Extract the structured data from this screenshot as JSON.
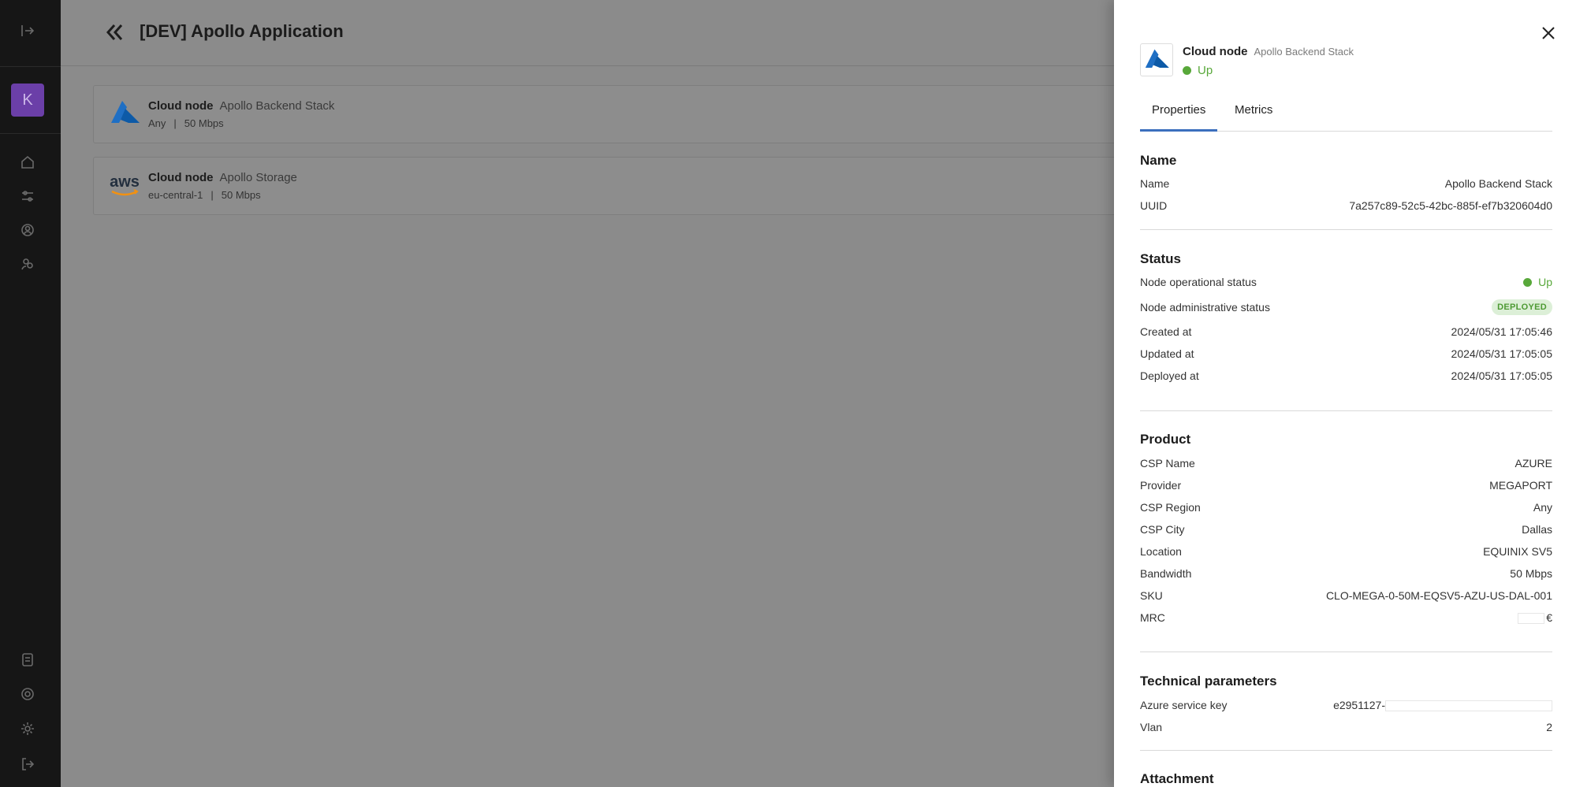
{
  "app": {
    "title": "[DEV] Apollo Application",
    "avatar_letter": "K"
  },
  "nodes": [
    {
      "type_label": "Cloud node",
      "name": "Apollo Backend Stack",
      "region": "Any",
      "bandwidth": "50 Mbps",
      "provider_icon": "azure-logo"
    },
    {
      "type_label": "Cloud node",
      "name": "Apollo Storage",
      "region": "eu-central-1",
      "bandwidth": "50 Mbps",
      "provider_icon": "aws-logo",
      "logo_text": "aws"
    }
  ],
  "drawer": {
    "type_label": "Cloud node",
    "name": "Apollo Backend Stack",
    "status": "Up",
    "tabs": [
      "Properties",
      "Metrics"
    ],
    "sections": {
      "name": {
        "title": "Name",
        "rows": [
          {
            "label": "Name",
            "value": "Apollo Backend Stack"
          },
          {
            "label": "UUID",
            "value": "7a257c89-52c5-42bc-885f-ef7b320604d0"
          }
        ]
      },
      "status": {
        "title": "Status",
        "operational_label": "Node operational status",
        "operational_value": "Up",
        "administrative_label": "Node administrative status",
        "administrative_value": "DEPLOYED",
        "rows": [
          {
            "label": "Created at",
            "value": "2024/05/31 17:05:46"
          },
          {
            "label": "Updated at",
            "value": "2024/05/31 17:05:05"
          },
          {
            "label": "Deployed at",
            "value": "2024/05/31 17:05:05"
          }
        ]
      },
      "product": {
        "title": "Product",
        "rows": [
          {
            "label": "CSP Name",
            "value": "AZURE"
          },
          {
            "label": "Provider",
            "value": "MEGAPORT"
          },
          {
            "label": "CSP Region",
            "value": "Any"
          },
          {
            "label": "CSP City",
            "value": "Dallas"
          },
          {
            "label": "Location",
            "value": "EQUINIX SV5"
          },
          {
            "label": "Bandwidth",
            "value": "50 Mbps"
          },
          {
            "label": "SKU",
            "value": "CLO-MEGA-0-50M-EQSV5-AZU-US-DAL-001"
          }
        ],
        "mrc_label": "MRC",
        "mrc_currency": "€"
      },
      "technical": {
        "title": "Technical parameters",
        "azure_key_label": "Azure service key",
        "azure_key_value": "e2951127-",
        "vlan_label": "Vlan",
        "vlan_value": "2"
      },
      "attachment": {
        "title": "Attachment"
      }
    }
  },
  "colors": {
    "accent": "#3b6fbd",
    "status_up": "#58a83a",
    "avatar": "#6b3fa8",
    "rail": "#161616"
  }
}
